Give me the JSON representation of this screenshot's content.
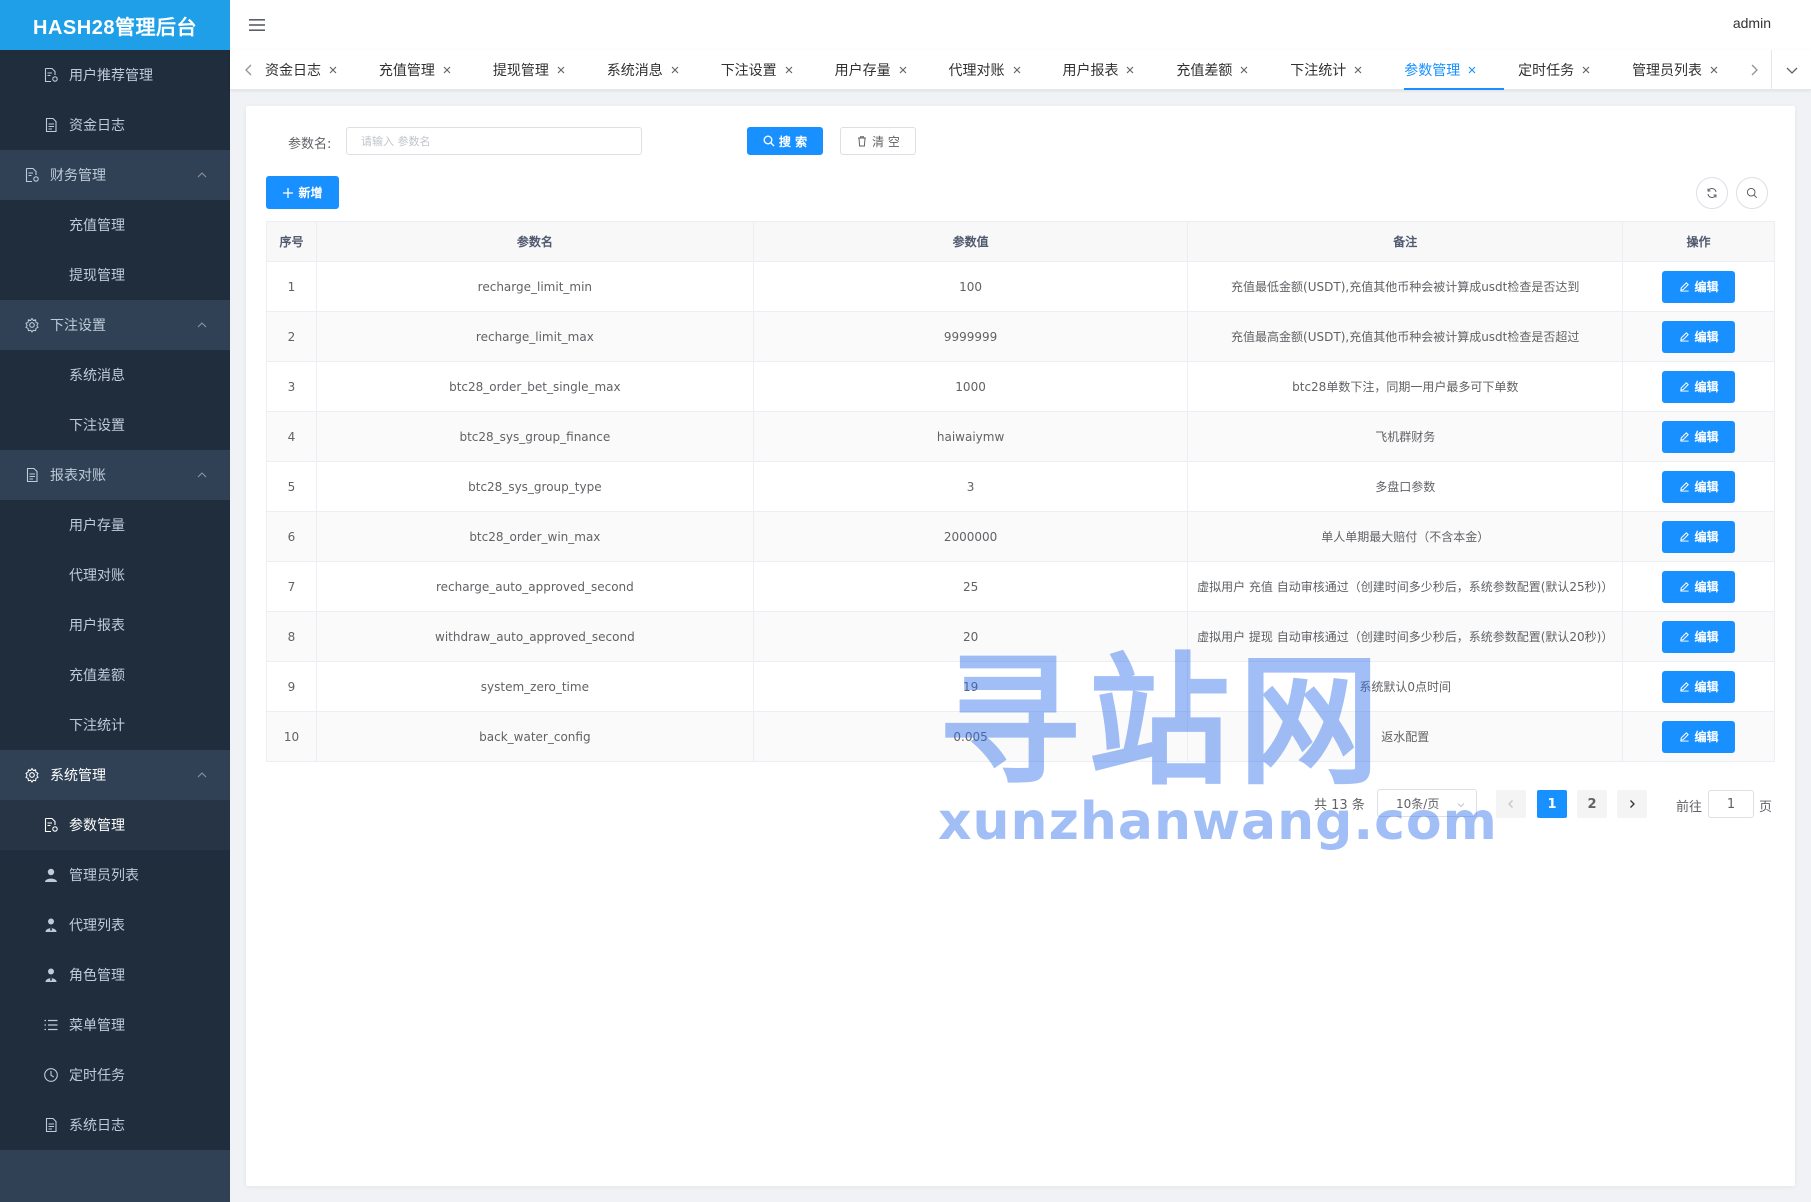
{
  "app": {
    "logo": "HASH28管理后台",
    "user": "admin"
  },
  "sidebar": {
    "items": [
      {
        "kind": "child",
        "label": "用户推荐管理",
        "icon": "document-gear-icon"
      },
      {
        "kind": "child",
        "label": "资金日志",
        "icon": "document-icon"
      },
      {
        "kind": "group",
        "label": "财务管理",
        "icon": "document-gear-icon"
      },
      {
        "kind": "child-noicon",
        "label": "充值管理"
      },
      {
        "kind": "child-noicon",
        "label": "提现管理"
      },
      {
        "kind": "group",
        "label": "下注设置",
        "icon": "gear-icon"
      },
      {
        "kind": "child-noicon",
        "label": "系统消息"
      },
      {
        "kind": "child-noicon",
        "label": "下注设置"
      },
      {
        "kind": "group",
        "label": "报表对账",
        "icon": "document-icon"
      },
      {
        "kind": "child-noicon",
        "label": "用户存量"
      },
      {
        "kind": "child-noicon",
        "label": "代理对账"
      },
      {
        "kind": "child-noicon",
        "label": "用户报表"
      },
      {
        "kind": "child-noicon",
        "label": "充值差额"
      },
      {
        "kind": "child-noicon",
        "label": "下注统计"
      },
      {
        "kind": "group-active",
        "label": "系统管理",
        "icon": "gear-icon"
      },
      {
        "kind": "child-active",
        "label": "参数管理",
        "icon": "document-gear-icon"
      },
      {
        "kind": "child",
        "label": "管理员列表",
        "icon": "user-icon"
      },
      {
        "kind": "child",
        "label": "代理列表",
        "icon": "user-tie-icon"
      },
      {
        "kind": "child",
        "label": "角色管理",
        "icon": "user-tie-icon"
      },
      {
        "kind": "child",
        "label": "菜单管理",
        "icon": "list-icon"
      },
      {
        "kind": "child",
        "label": "定时任务",
        "icon": "clock-icon"
      },
      {
        "kind": "child",
        "label": "系统日志",
        "icon": "document-icon"
      }
    ]
  },
  "tags": [
    {
      "label": "资金日志",
      "active": false
    },
    {
      "label": "充值管理",
      "active": false
    },
    {
      "label": "提现管理",
      "active": false
    },
    {
      "label": "系统消息",
      "active": false
    },
    {
      "label": "下注设置",
      "active": false
    },
    {
      "label": "用户存量",
      "active": false
    },
    {
      "label": "代理对账",
      "active": false
    },
    {
      "label": "用户报表",
      "active": false
    },
    {
      "label": "充值差额",
      "active": false
    },
    {
      "label": "下注统计",
      "active": false
    },
    {
      "label": "参数管理",
      "active": true
    },
    {
      "label": "定时任务",
      "active": false
    },
    {
      "label": "管理员列表",
      "active": false
    }
  ],
  "search": {
    "label": "参数名:",
    "placeholder": "请输入 参数名",
    "value": "",
    "search_btn": "搜 索",
    "clear_btn": "清 空",
    "add_btn": "新增"
  },
  "table": {
    "headers": [
      "序号",
      "参数名",
      "参数值",
      "备注",
      "操作"
    ],
    "edit_label": "编辑",
    "rows": [
      {
        "idx": "1",
        "name": "recharge_limit_min",
        "value": "100",
        "remark": "充值最低金额(USDT),充值其他币种会被计算成usdt检查是否达到"
      },
      {
        "idx": "2",
        "name": "recharge_limit_max",
        "value": "9999999",
        "remark": "充值最高金额(USDT),充值其他币种会被计算成usdt检查是否超过"
      },
      {
        "idx": "3",
        "name": "btc28_order_bet_single_max",
        "value": "1000",
        "remark": "btc28单数下注，同期一用户最多可下单数"
      },
      {
        "idx": "4",
        "name": "btc28_sys_group_finance",
        "value": "haiwaiymw",
        "remark": "飞机群财务"
      },
      {
        "idx": "5",
        "name": "btc28_sys_group_type",
        "value": "3",
        "remark": "多盘口参数"
      },
      {
        "idx": "6",
        "name": "btc28_order_win_max",
        "value": "2000000",
        "remark": "单人单期最大赔付（不含本金）"
      },
      {
        "idx": "7",
        "name": "recharge_auto_approved_second",
        "value": "25",
        "remark": "虚拟用户 充值 自动审核通过（创建时间多少秒后，系统参数配置(默认25秒)）"
      },
      {
        "idx": "8",
        "name": "withdraw_auto_approved_second",
        "value": "20",
        "remark": "虚拟用户 提现 自动审核通过（创建时间多少秒后，系统参数配置(默认20秒)）"
      },
      {
        "idx": "9",
        "name": "system_zero_time",
        "value": "19",
        "remark": "系统默认0点时间"
      },
      {
        "idx": "10",
        "name": "back_water_config",
        "value": "0.005",
        "remark": "返水配置"
      }
    ]
  },
  "pagination": {
    "total": "共 13 条",
    "page_size": "10条/页",
    "pages": [
      "1",
      "2"
    ],
    "current": "1",
    "goto_label": "前往",
    "goto_value": "1",
    "page_suffix": "页"
  },
  "watermark": {
    "big": "寻站网",
    "small": "xunzhanwang.com"
  },
  "colors": {
    "primary": "#1890ff",
    "sidebar": "#304156",
    "logo": "#1e9fe8"
  }
}
